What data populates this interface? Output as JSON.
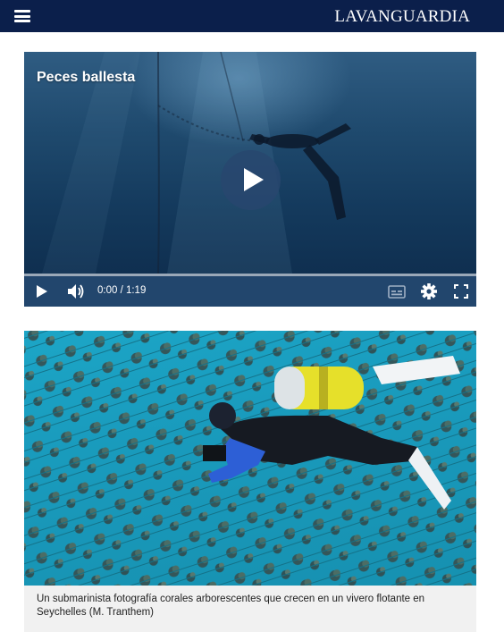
{
  "header": {
    "logo_text": "LAVANGUARDIA",
    "menu_icon": "hamburger-menu-icon",
    "background_color": "#0b1f4b"
  },
  "video": {
    "title": "Peces ballesta",
    "time_display": "0:00 / 1:19",
    "progress": 0,
    "controls": {
      "play_icon": "play-icon",
      "volume_icon": "volume-icon",
      "subtitles_icon": "subtitles-icon",
      "settings_icon": "gear-icon",
      "fullscreen_icon": "fullscreen-icon"
    }
  },
  "photo": {
    "caption": "Un submarinista fotografía corales arborescentes que crecen en un vivero flotante en Seychelles (M. Tranthem)"
  }
}
